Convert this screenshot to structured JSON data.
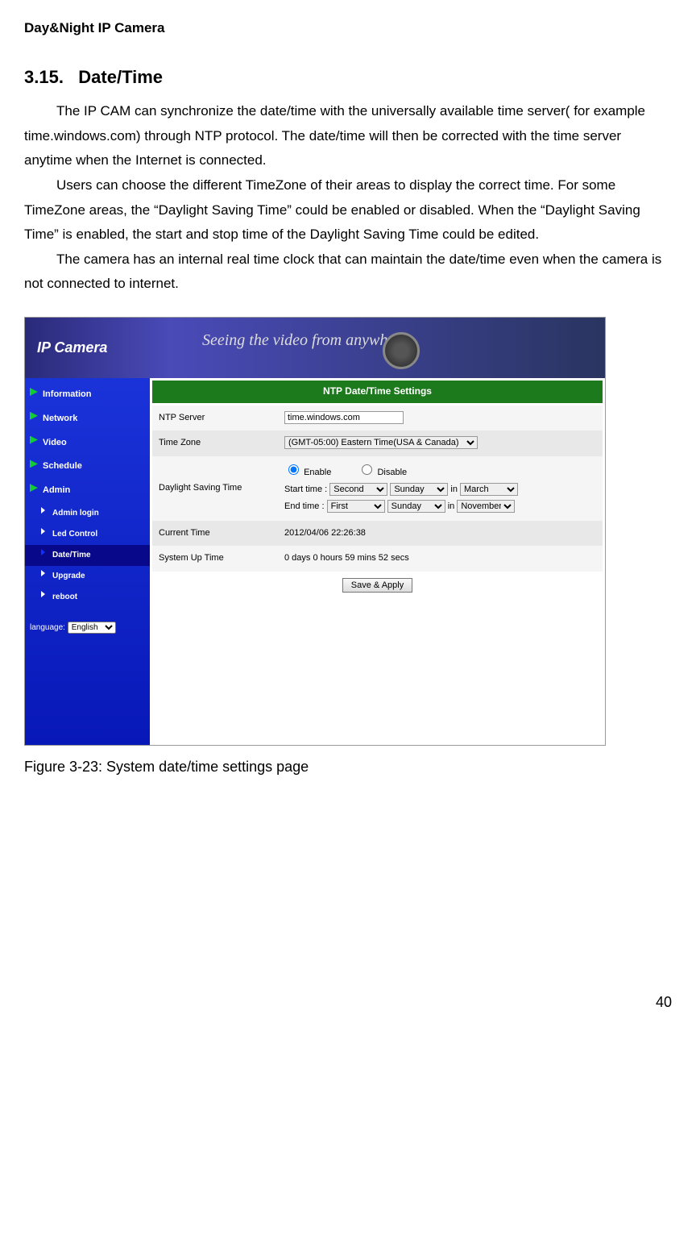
{
  "header": {
    "doc_title": "Day&Night IP Camera"
  },
  "section": {
    "number": "3.15.",
    "title": "Date/Time",
    "p1": "The IP CAM can synchronize the date/time with the universally available time server( for example time.windows.com) through NTP protocol. The date/time will then be corrected with the time server anytime when the Internet is connected.",
    "p2": "Users can choose the different TimeZone of their areas to display the correct time. For some TimeZone areas, the “Daylight Saving Time” could be enabled or disabled. When the “Daylight Saving Time” is enabled, the start and stop time of the Daylight Saving Time could be edited.",
    "p3": "The camera has an internal real time clock that can maintain the date/time even when the camera is not connected to internet."
  },
  "ui": {
    "banner_logo": "IP Camera",
    "banner_slogan": "Seeing the video from anywhere",
    "sidebar": {
      "items": [
        "Information",
        "Network",
        "Video",
        "Schedule",
        "Admin"
      ],
      "sub": [
        "Admin login",
        "Led Control",
        "Date/Time",
        "Upgrade",
        "reboot"
      ],
      "lang_label": "language:",
      "lang_value": "English"
    },
    "content": {
      "title": "NTP Date/Time Settings",
      "rows": {
        "ntp_label": "NTP Server",
        "ntp_value": "time.windows.com",
        "tz_label": "Time Zone",
        "tz_value": "(GMT-05:00) Eastern Time(USA & Canada)",
        "dst_label": "Daylight Saving Time",
        "dst_enable": "Enable",
        "dst_disable": "Disable",
        "dst_start": "Start time :",
        "dst_end": "End time  :",
        "dst_start_week": "Second",
        "dst_start_day": "Sunday",
        "dst_start_in": "in",
        "dst_start_month": "March",
        "dst_end_week": "First",
        "dst_end_day": "Sunday",
        "dst_end_in": "in",
        "dst_end_month": "November",
        "ct_label": "Current Time",
        "ct_value": "2012/04/06 22:26:38",
        "ut_label": "System Up Time",
        "ut_value": "0 days 0 hours 59 mins 52 secs",
        "save": "Save & Apply"
      }
    }
  },
  "figure_caption": "Figure 3-23: System date/time settings page",
  "page_number": "40"
}
